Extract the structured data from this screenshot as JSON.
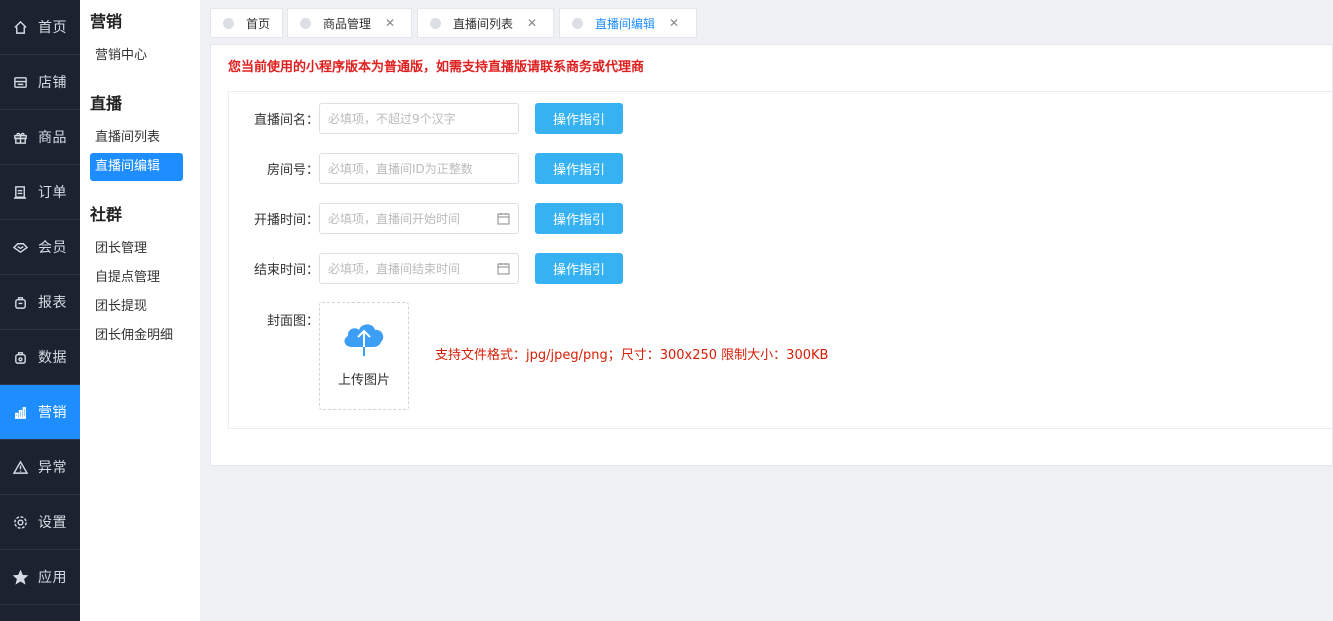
{
  "nav": {
    "items": [
      {
        "label": "首页",
        "icon": "home-icon",
        "active": false
      },
      {
        "label": "店铺",
        "icon": "shop-icon",
        "active": false
      },
      {
        "label": "商品",
        "icon": "gift-icon",
        "active": false
      },
      {
        "label": "订单",
        "icon": "order-icon",
        "active": false
      },
      {
        "label": "会员",
        "icon": "member-icon",
        "active": false
      },
      {
        "label": "报表",
        "icon": "report-icon",
        "active": false
      },
      {
        "label": "数据",
        "icon": "data-icon",
        "active": false
      },
      {
        "label": "营销",
        "icon": "marketing-icon",
        "active": true
      },
      {
        "label": "异常",
        "icon": "warning-icon",
        "active": false
      },
      {
        "label": "设置",
        "icon": "settings-icon",
        "active": false
      },
      {
        "label": "应用",
        "icon": "star-icon",
        "active": false
      }
    ]
  },
  "submenu": {
    "groups": [
      {
        "title": "营销",
        "items": [
          {
            "label": "营销中心",
            "active": false
          }
        ]
      },
      {
        "title": "直播",
        "items": [
          {
            "label": "直播间列表",
            "active": false
          },
          {
            "label": "直播间编辑",
            "active": true
          }
        ]
      },
      {
        "title": "社群",
        "items": [
          {
            "label": "团长管理",
            "active": false
          },
          {
            "label": "自提点管理",
            "active": false
          },
          {
            "label": "团长提现",
            "active": false
          },
          {
            "label": "团长佣金明细",
            "active": false
          }
        ]
      }
    ]
  },
  "tabs": [
    {
      "label": "首页",
      "closable": false,
      "active": false
    },
    {
      "label": "商品管理",
      "closable": true,
      "active": false
    },
    {
      "label": "直播间列表",
      "closable": true,
      "active": false
    },
    {
      "label": "直播间编辑",
      "closable": true,
      "active": true
    }
  ],
  "notice": "您当前使用的小程序版本为普通版，如需支持直播版请联系商务或代理商",
  "form": {
    "fields": [
      {
        "label": "直播间名：",
        "placeholder": "必填项，不超过9个汉字",
        "has_calendar": false,
        "button": "操作指引"
      },
      {
        "label": "房间号：",
        "placeholder": "必填项，直播间ID为正整数",
        "has_calendar": false,
        "button": "操作指引"
      },
      {
        "label": "开播时间：",
        "placeholder": "必填项，直播间开始时间",
        "has_calendar": true,
        "button": "操作指引"
      },
      {
        "label": "结束时间：",
        "placeholder": "必填项，直播间结束时间",
        "has_calendar": true,
        "button": "操作指引"
      }
    ],
    "cover_label": "封面图：",
    "upload_text": "上传图片",
    "upload_hint": "支持文件格式：jpg/jpeg/png；尺寸：300x250 限制大小：300KB"
  },
  "colors": {
    "accent": "#1e8dff",
    "button": "#36b2f3",
    "notice": "#e02020",
    "hint": "#d81e06",
    "nav_bg": "#1b2330"
  }
}
